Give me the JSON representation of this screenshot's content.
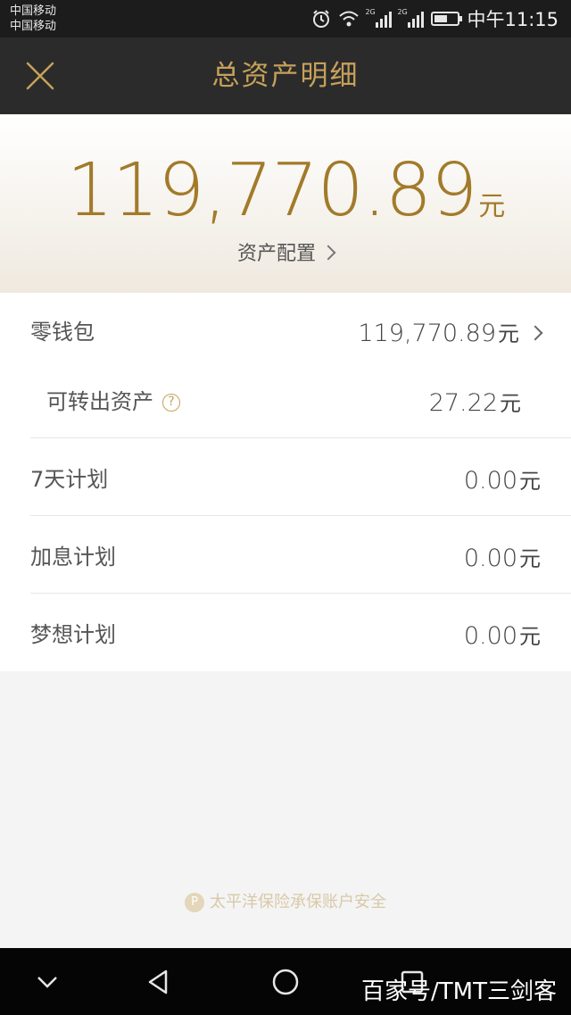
{
  "status_bar": {
    "carrier_1": "中国移动",
    "carrier_2": "中国移动",
    "network_1": "2G",
    "network_2": "2G",
    "time": "中午11:15",
    "battery_level": 0.6
  },
  "header": {
    "title": "总资产明细",
    "close_icon": "close-icon"
  },
  "summary": {
    "total_amount": "119,770.89",
    "unit": "元",
    "allocation_label": "资产配置"
  },
  "rows": [
    {
      "label": "零钱包",
      "value": "119,770.89",
      "unit": "元"
    },
    {
      "label": "可转出资产",
      "value": "27.22",
      "unit": "元",
      "help_icon": "?"
    },
    {
      "label": "7天计划",
      "value": "0.00",
      "unit": "元"
    },
    {
      "label": "加息计划",
      "value": "0.00",
      "unit": "元"
    },
    {
      "label": "梦想计划",
      "value": "0.00",
      "unit": "元"
    }
  ],
  "footer": {
    "insurance_note": "太平洋保险承保账户安全",
    "shield_icon": "P"
  },
  "watermark": "百家号/TMT三剑客",
  "colors": {
    "accent_gold": "#c6a15a",
    "amount_gold": "#a27a2a",
    "header_bg": "#2b2b2b"
  }
}
